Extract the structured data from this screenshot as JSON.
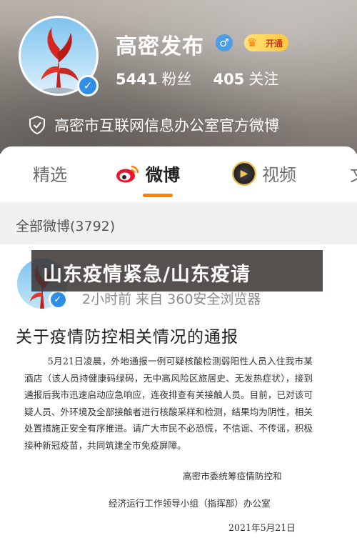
{
  "profile": {
    "name": "高密发布",
    "gender_icon": "male-icon",
    "vip_label": "开通",
    "followers_count": "5441",
    "followers_label": "粉丝",
    "following_count": "405",
    "following_label": "关注",
    "certification": "高密市互联网信息办公室官方微博"
  },
  "tabs": [
    {
      "label": "精选",
      "icon": null,
      "active": false
    },
    {
      "label": "微博",
      "icon": "weibo-logo-icon",
      "active": true
    },
    {
      "label": "视频",
      "icon": "video-logo-icon",
      "active": false
    },
    {
      "label": "文",
      "icon": null,
      "active": false
    }
  ],
  "section": {
    "label": "全部微博(3792)"
  },
  "post": {
    "meta": "2小时前  来自 360安全浏览器",
    "title": "关于疫情防控相关情况的通报",
    "notice_body": "5月21日凌晨，外地通报一例可疑核酸检测弱阳性人员入住我市某酒店（该人员持健康码绿码，无中高风险区旅居史、无发热症状），接到通报后我市迅速启动应急响应，连夜排查有关接触人员。目前，已对该可疑人员、外环境及全部接触者进行核酸采样和检测，结果均为阴性，相关处置措施正安全有序推进。请广大市民不必恐慌，不信谣、不传谣，积极接种新冠疫苗，共同筑建全市免疫屏障。",
    "notice_org_line1": "高密市委统筹疫情防控和",
    "notice_org_line2": "经济运行工作领导小组（指挥部）办公室",
    "notice_date": "2021年5月21日"
  },
  "overlay": {
    "caption": "山东疫情紧急/山东疫请"
  },
  "colors": {
    "accent_orange": "#ff8200",
    "verified_blue": "#2f8fe6",
    "header_bg": "#9c958f"
  }
}
